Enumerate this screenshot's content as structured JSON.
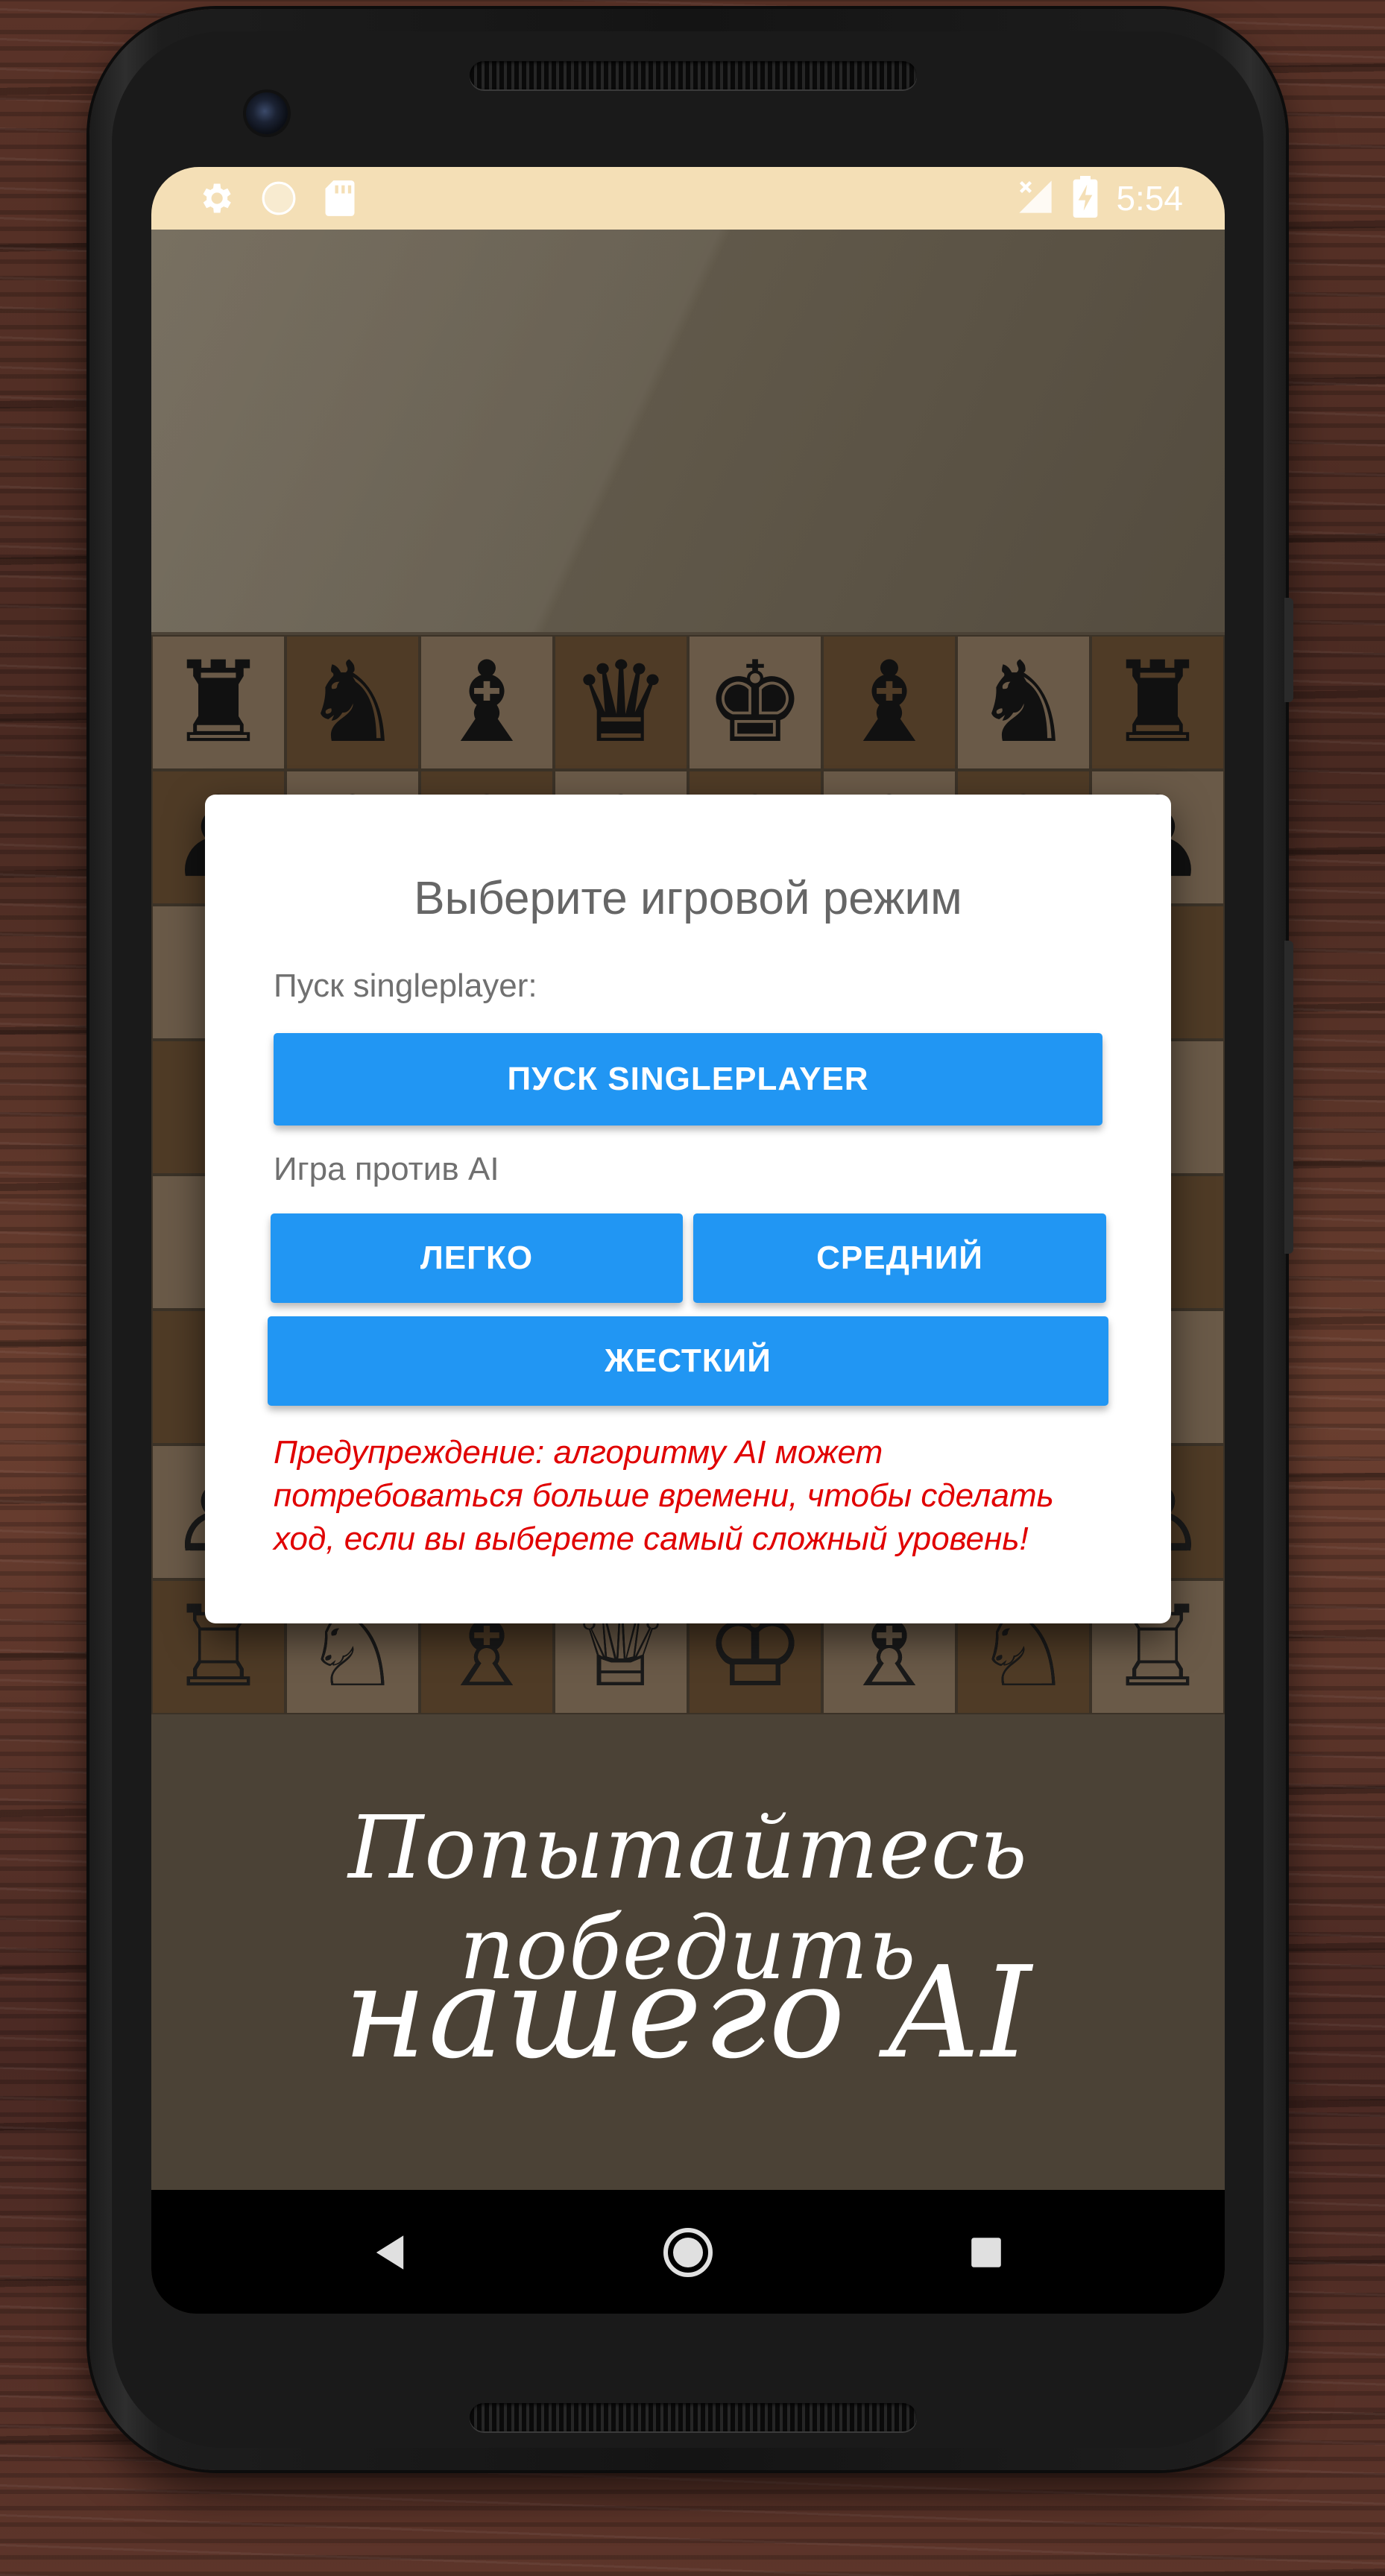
{
  "status_bar": {
    "time": "5:54",
    "icons": [
      "gear-icon",
      "circle-icon",
      "sd-card-icon",
      "no-signal-icon",
      "battery-charging-icon"
    ]
  },
  "dialog": {
    "title": "Выберите игровой режим",
    "singleplayer_label": "Пуск singleplayer:",
    "singleplayer_button": "ПУСК SINGLEPLAYER",
    "ai_label": "Игра против AI",
    "easy_button": "ЛЕГКО",
    "medium_button": "СРЕДНИЙ",
    "hard_button": "ЖЕСТКИЙ",
    "warning": "Предупреждение: алгоритму AI может потребоваться больше времени, чтобы сделать ход, если вы выберете самый сложный уровень!"
  },
  "promo": {
    "line1": "Попытайтесь победить",
    "line2": "нашего AI"
  },
  "board": {
    "black_back_rank": [
      "♜",
      "♞",
      "♝",
      "♛",
      "♚",
      "♝",
      "♞",
      "♜"
    ],
    "black_pawns": [
      "♟",
      "♟",
      "♟",
      "♟",
      "♟",
      "♟",
      "♟",
      "♟"
    ],
    "white_pawns": [
      "♙",
      "♙",
      "♙",
      "♙",
      "♙",
      "♙",
      "♙",
      "♙"
    ],
    "white_back_rank": [
      "♖",
      "♘",
      "♗",
      "♕",
      "♔",
      "♗",
      "♘",
      "♖"
    ]
  },
  "nav_bar": {
    "icons": [
      "back-triangle-icon",
      "home-circle-icon",
      "recents-square-icon"
    ]
  },
  "colors": {
    "accent_button": "#2196f3",
    "warning_text": "#e00000",
    "status_bar": "#f4dfb6",
    "light_square": "#6a5a48",
    "dark_square": "#4f3b26"
  }
}
